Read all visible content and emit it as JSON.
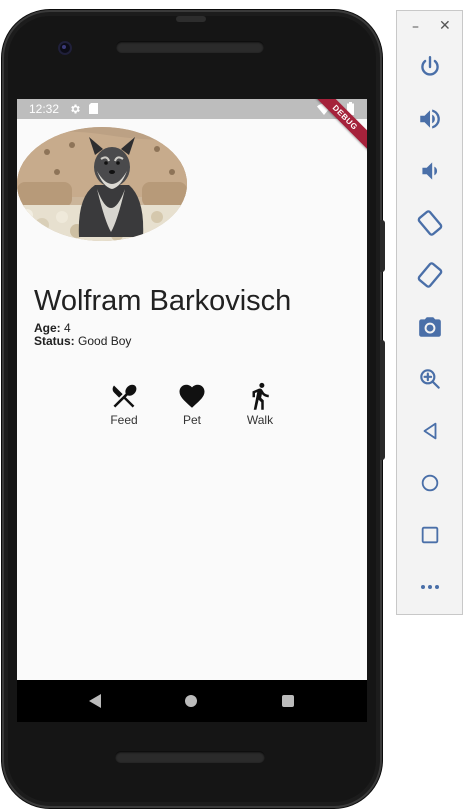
{
  "status_bar": {
    "time": "12:32"
  },
  "debug_banner": "DEBUG",
  "dog": {
    "name": "Wolfram Barkovisch",
    "age_label": "Age:",
    "age_value": "4",
    "status_label": "Status:",
    "status_value": "Good Boy"
  },
  "actions": [
    {
      "label": "Feed",
      "icon": "restaurant-icon"
    },
    {
      "label": "Pet",
      "icon": "heart-icon"
    },
    {
      "label": "Walk",
      "icon": "walk-icon"
    }
  ],
  "emulator_toolbar": {
    "buttons": [
      "power-icon",
      "volume-up-icon",
      "volume-down-icon",
      "rotate-left-icon",
      "rotate-right-icon",
      "screenshot-icon",
      "zoom-icon",
      "back-icon",
      "home-icon",
      "overview-icon",
      "more-icon"
    ]
  },
  "colors": {
    "accent_debug": "#a5223b",
    "icon": "#111111",
    "toolbar_icon": "#4a6fa8"
  }
}
